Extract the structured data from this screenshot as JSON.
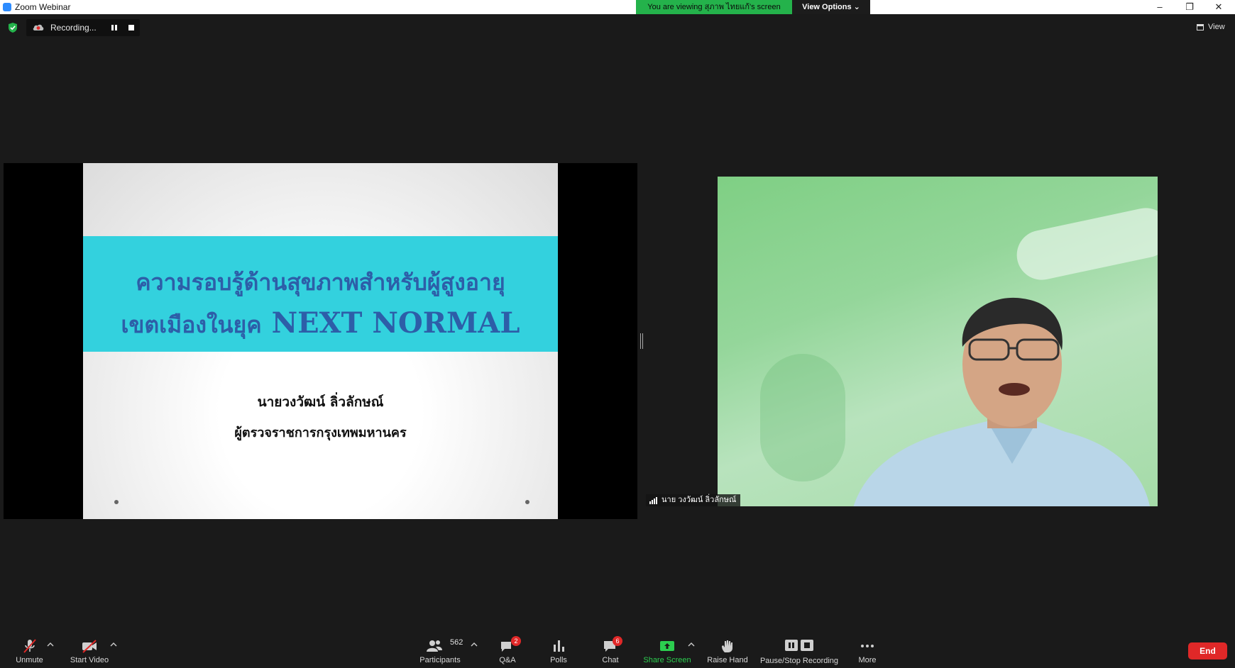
{
  "window": {
    "title": "Zoom Webinar",
    "minimize": "–",
    "restore": "❐",
    "close": "✕"
  },
  "banner": {
    "viewing_text": "You are viewing สุภาพ ไทยแก้'s screen",
    "view_options": "View Options ⌄"
  },
  "recording": {
    "status": "Recording...",
    "pause_icon": "pause-icon",
    "stop_icon": "stop-icon"
  },
  "view_button": {
    "label": "View"
  },
  "slide": {
    "title_line1": "ความรอบรู้ด้านสุขภาพสำหรับผู้สูงอายุ",
    "title_line2_thai": "เขตเมืองในยุค",
    "title_line2_en": "NEXT NORMAL",
    "presenter_name": "นายวงวัฒน์  ลิ่วลักษณ์",
    "presenter_role": "ผู้ตรวจราชการกรุงเทพมหานคร"
  },
  "video": {
    "participant_name": "นาย วงวัฒน์ ลิ่วลักษณ์"
  },
  "toolbar": {
    "unmute": "Unmute",
    "start_video": "Start Video",
    "participants": "Participants",
    "participants_count": "562",
    "qa": "Q&A",
    "qa_badge": "2",
    "polls": "Polls",
    "chat": "Chat",
    "chat_badge": "6",
    "share_screen": "Share Screen",
    "raise_hand": "Raise Hand",
    "pause_stop_recording": "Pause/Stop Recording",
    "more": "More",
    "end": "End"
  },
  "colors": {
    "accent_green": "#24b24b",
    "share_green": "#2ccd4f",
    "end_red": "#e02828",
    "slide_band": "#33d1de",
    "slide_title": "#2d5ea8"
  }
}
